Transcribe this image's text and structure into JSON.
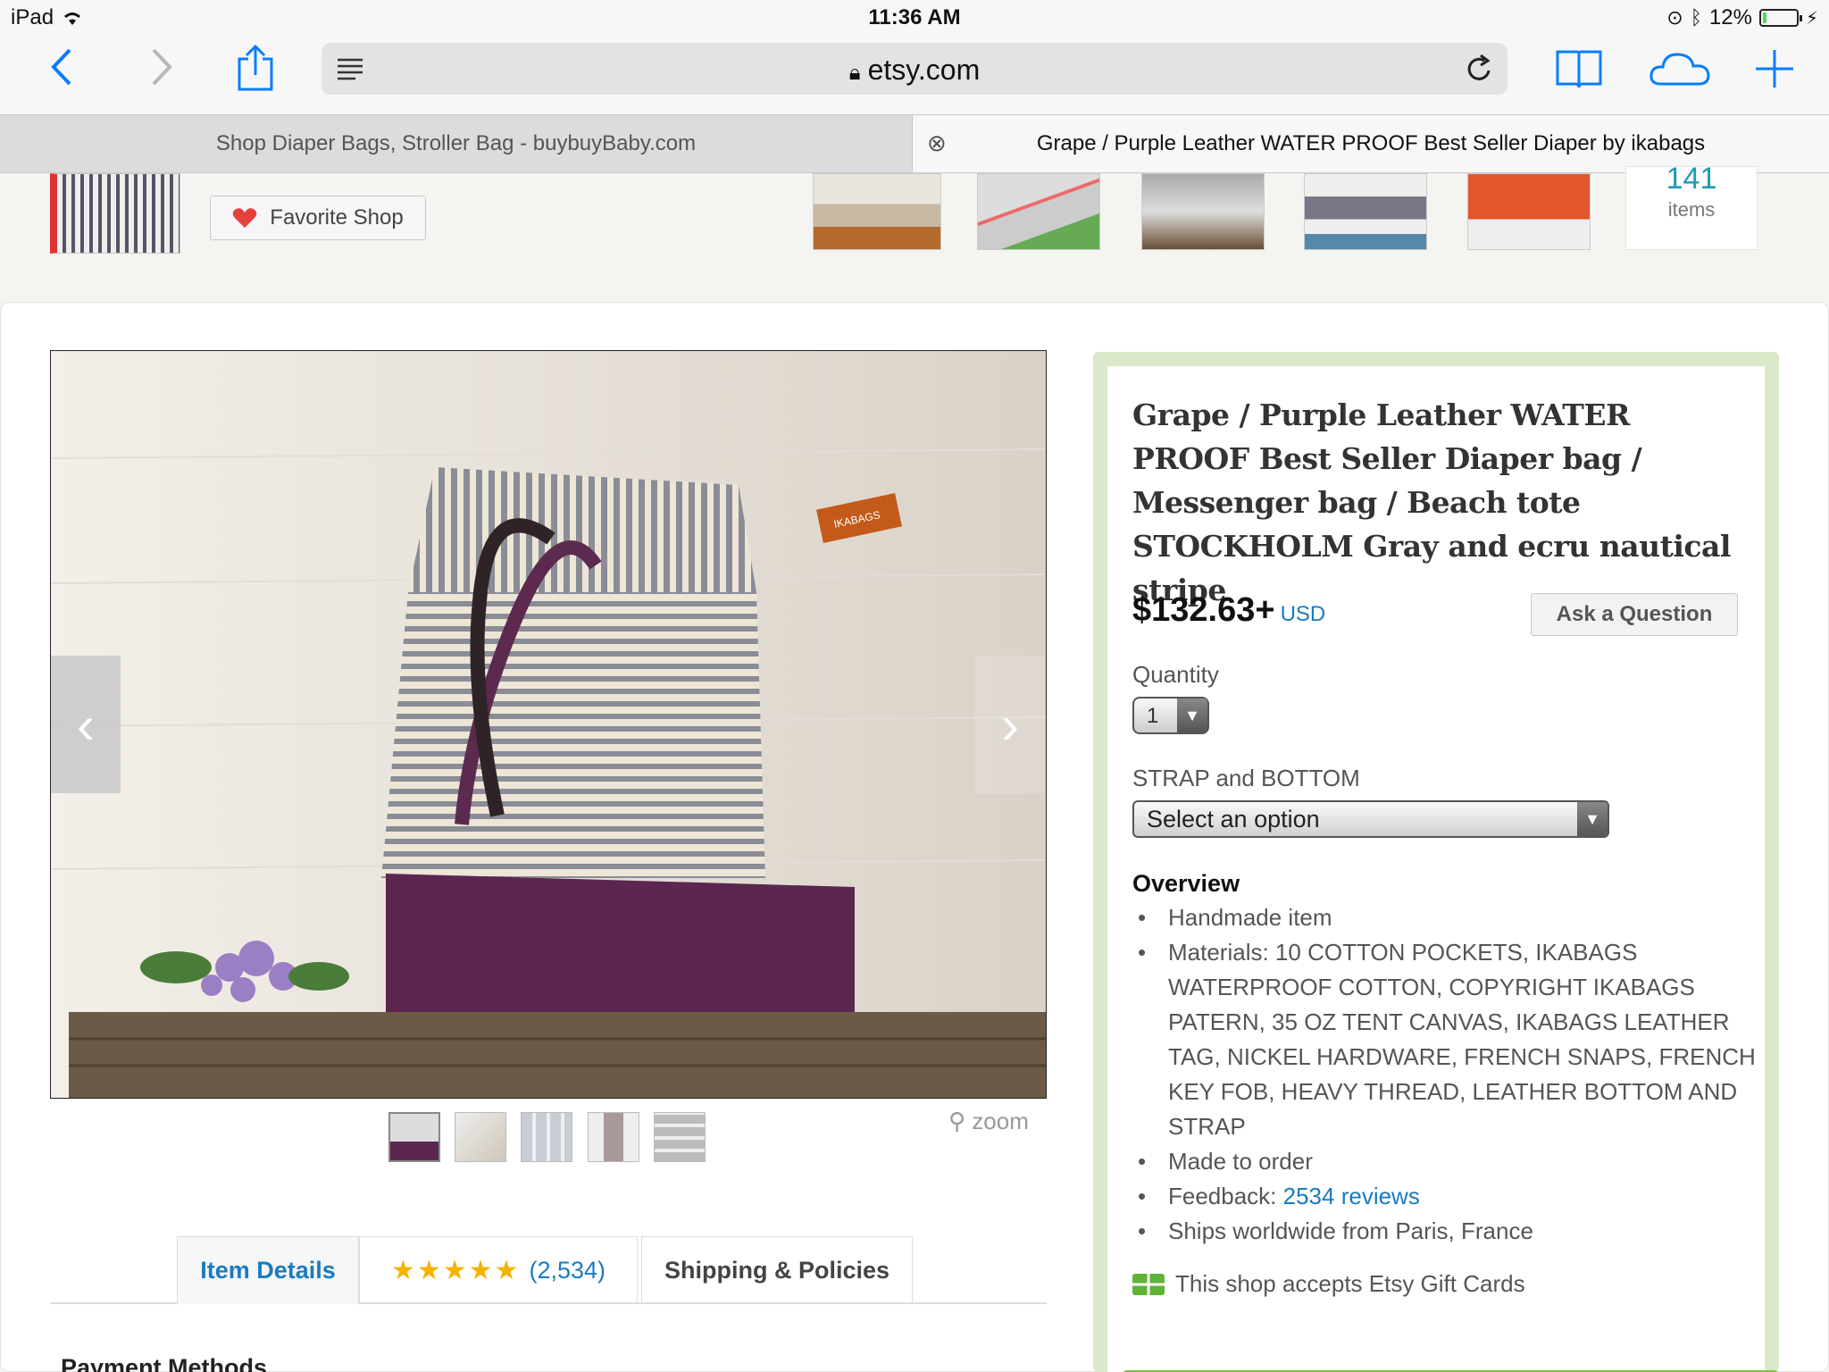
{
  "status_bar": {
    "device": "iPad",
    "time": "11:36 AM",
    "battery": "12%",
    "battery_level": 0.12
  },
  "browser": {
    "url": "etsy.com",
    "tabs": [
      {
        "title": "Shop Diaper Bags, Stroller Bag - buybuyBaby.com",
        "active": false
      },
      {
        "title": "Grape / Purple Leather WATER PROOF Best Seller Diaper by ikabags",
        "active": true
      }
    ]
  },
  "shop": {
    "favorite_label": "Favorite Shop",
    "items_count": "141",
    "items_label": "items"
  },
  "listing": {
    "title": "Grape / Purple Leather WATER PROOF Best Seller Diaper bag / Messenger bag / Beach tote STOCKHOLM Gray and ecru nautical stripe",
    "price": "$132.63+",
    "currency": "USD",
    "ask_label": "Ask a Question",
    "quantity_label": "Quantity",
    "quantity_value": "1",
    "strap_label": "STRAP and BOTTOM",
    "strap_value": "Select an option",
    "overview_heading": "Overview",
    "overview": {
      "handmade": "Handmade item",
      "materials": "Materials: 10 COTTON POCKETS, IKABAGS WATERPROOF COTTON, COPYRIGHT IKABAGS PATERN, 35 OZ TENT CANVAS, IKABAGS LEATHER TAG, NICKEL HARDWARE, FRENCH SNAPS, FRENCH KEY FOB, HEAVY THREAD, LEATHER BOTTOM AND STRAP",
      "made_to_order": "Made to order",
      "feedback_label": "Feedback:",
      "feedback_link": "2534 reviews",
      "ships": "Ships worldwide from Paris, France"
    },
    "gift_cards": "This shop accepts Etsy Gift Cards",
    "zoom_label": "zoom",
    "brand_tag": "IKABAGS"
  },
  "detail_tabs": {
    "item_details": "Item Details",
    "reviews_count": "(2,534)",
    "rating_stars": 5,
    "shipping": "Shipping & Policies"
  },
  "payment_heading": "Payment Methods",
  "colors": {
    "accent_blue": "#1a7bbf",
    "ios_blue": "#0a7cff",
    "etsy_green": "#7bc143",
    "panel_green": "#dbe8c9"
  }
}
